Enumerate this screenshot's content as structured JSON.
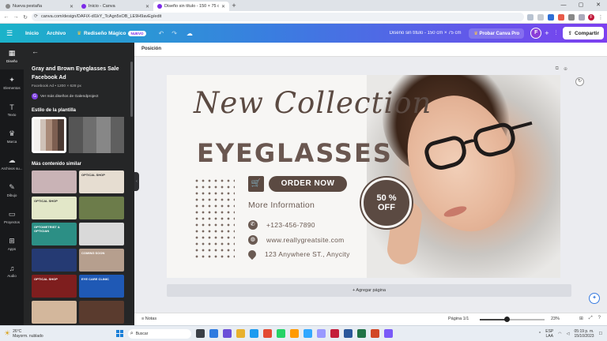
{
  "browser": {
    "tabs": [
      {
        "label": "Nueva pestaña",
        "active": false
      },
      {
        "label": "Inicio - Canva",
        "active": false
      },
      {
        "label": "Diseño sin título - 150 × 75 cm",
        "active": true
      }
    ],
    "url": "canva.com/design/DAFiX-dl1kY_TcAgn5xOB_LE9H9avEg/edit"
  },
  "header": {
    "home": "Inicio",
    "file": "Archivo",
    "magic_resize": "Rediseño Mágico",
    "new_badge": "NUEVO",
    "doc_title": "Diseño sin título - 150 cm × 75 cm",
    "try_pro": "Probar Canva Pro",
    "avatar_letter": "F",
    "share": "Compartir"
  },
  "rail": [
    {
      "icon": "design-icon",
      "glyph": "▦",
      "label": "Diseño",
      "active": true
    },
    {
      "icon": "elements-icon",
      "glyph": "✦",
      "label": "Elementos",
      "active": false
    },
    {
      "icon": "text-icon",
      "glyph": "T",
      "label": "Texto",
      "active": false
    },
    {
      "icon": "brand-icon",
      "glyph": "♛",
      "label": "Marca",
      "active": false
    },
    {
      "icon": "upload-icon",
      "glyph": "☁",
      "label": "Archivos su...",
      "active": false
    },
    {
      "icon": "draw-icon",
      "glyph": "✎",
      "label": "Dibujo",
      "active": false
    },
    {
      "icon": "projects-icon",
      "glyph": "▭",
      "label": "Proyectos",
      "active": false
    },
    {
      "icon": "apps-icon",
      "glyph": "⊞",
      "label": "Apps",
      "active": false
    },
    {
      "icon": "audio-icon",
      "glyph": "♫",
      "label": "Audio",
      "active": false
    }
  ],
  "panel": {
    "title": "Gray and Brown Eyeglasses Sale Facebook Ad",
    "subtitle": "Facebook Ad • 1200 × 628 px",
    "author_link": "Ver más diseños de Galendproject",
    "style_heading": "Estilo de la plantilla",
    "similar_heading": "Más contenido similar",
    "palette_main": [
      "#f3f1ee",
      "#cfc1b7",
      "#a98a78",
      "#7d5f51",
      "#4b3a33"
    ],
    "palette_alt": [
      "#555555",
      "#6e6e6e",
      "#878787",
      "#5f5f5f"
    ],
    "thumbnails": [
      {
        "label": "",
        "bg": "#c9b3b6"
      },
      {
        "label": "OPTICAL SHOP",
        "bg": "#e6ddd1"
      },
      {
        "label": "OPTICAL SHOP",
        "bg": "#e2e7c8"
      },
      {
        "label": "",
        "bg": "#6c7c4a"
      },
      {
        "label": "OPTOMETRIST & OPTICIAN",
        "bg": "#2c8f85"
      },
      {
        "label": "",
        "bg": "#d9d9d9"
      },
      {
        "label": "",
        "bg": "#253a73"
      },
      {
        "label": "COMING SOON",
        "bg": "#b69f8e"
      },
      {
        "label": "OPTICAL SHOP",
        "bg": "#7e1e1e"
      },
      {
        "label": "EYE CARE CLINIC",
        "bg": "#1f59b5"
      },
      {
        "label": "",
        "bg": "#d3b79c"
      },
      {
        "label": "",
        "bg": "#5a3b2e"
      }
    ]
  },
  "editor": {
    "position_label": "Posición",
    "add_page": "+ Agregar página",
    "notes": "Notas",
    "page_indicator": "Página 1/1",
    "zoom": "23%",
    "zoom_fraction": 0.23
  },
  "design": {
    "headline_script": "New Collection",
    "headline": "EYEGLASSES",
    "cta": "ORDER NOW",
    "discount_line1": "50 %",
    "discount_line2": "OFF",
    "more_info": "More Information",
    "phone": "+123-456-7890",
    "website": "www.reallygreatsite.com",
    "address": "123 Anywhere ST., Anycity",
    "accent_color": "#5b4a42"
  },
  "taskbar": {
    "weather_temp": "26°C",
    "weather_desc": "Mayorm. nublado",
    "search": "Buscar",
    "lang": "ESP",
    "lang_sub": "LAA",
    "time": "05:19 p. m.",
    "date": "15/10/2023"
  }
}
